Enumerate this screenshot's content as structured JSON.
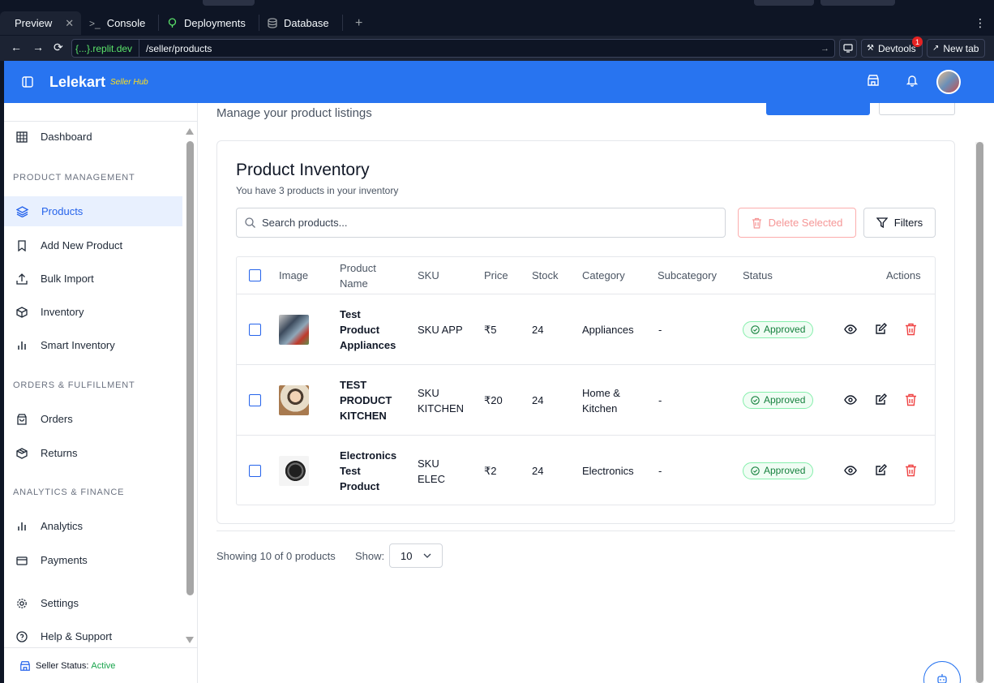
{
  "ide": {
    "tabs": [
      {
        "label": "Preview",
        "icon": "monitor-icon",
        "active": true
      },
      {
        "label": "Console",
        "icon": "terminal-icon"
      },
      {
        "label": "Deployments",
        "icon": "deploy-icon"
      },
      {
        "label": "Database",
        "icon": "database-icon"
      }
    ],
    "url_host": "{...}.replit.dev",
    "url_path": "/seller/products",
    "devtools_label": "Devtools",
    "devtools_badge": "1",
    "newtab_label": "New tab"
  },
  "app": {
    "brand": "Lelekart",
    "brand_sub": "Seller Hub",
    "sidebar": {
      "dashboard": "Dashboard",
      "sections": {
        "product": "PRODUCT MANAGEMENT",
        "orders": "ORDERS & FULFILLMENT",
        "analytics": "ANALYTICS & FINANCE"
      },
      "items": {
        "products": "Products",
        "add_new": "Add New Product",
        "bulk_import": "Bulk Import",
        "inventory": "Inventory",
        "smart_inventory": "Smart Inventory",
        "orders": "Orders",
        "returns": "Returns",
        "analytics": "Analytics",
        "payments": "Payments",
        "settings": "Settings",
        "help": "Help & Support"
      },
      "footer_label": "Seller Status:",
      "footer_value": "Active"
    },
    "page_subtitle": "Manage your product listings",
    "card": {
      "title": "Product Inventory",
      "subtitle": "You have 3 products in your inventory",
      "search_placeholder": "Search products...",
      "delete_label": "Delete Selected",
      "filters_label": "Filters"
    },
    "table": {
      "headers": {
        "image": "Image",
        "name_1": "Product",
        "name_2": "Name",
        "sku": "SKU",
        "price": "Price",
        "stock": "Stock",
        "category": "Category",
        "subcategory": "Subcategory",
        "status": "Status",
        "actions": "Actions"
      },
      "rows": [
        {
          "name_lines": [
            "Test",
            "Product",
            "Appliances"
          ],
          "sku_lines": [
            "SKU APP"
          ],
          "price": "₹5",
          "stock": "24",
          "category_lines": [
            "Appliances"
          ],
          "subcategory": "-",
          "status": "Approved"
        },
        {
          "name_lines": [
            "TEST",
            "PRODUCT",
            "KITCHEN"
          ],
          "sku_lines": [
            "SKU",
            "KITCHEN"
          ],
          "price": "₹20",
          "stock": "24",
          "category_lines": [
            "Home &",
            "Kitchen"
          ],
          "subcategory": "-",
          "status": "Approved"
        },
        {
          "name_lines": [
            "Electronics",
            "Test",
            "Product"
          ],
          "sku_lines": [
            "SKU",
            "ELEC"
          ],
          "price": "₹2",
          "stock": "24",
          "category_lines": [
            "Electronics"
          ],
          "subcategory": "-",
          "status": "Approved"
        }
      ]
    },
    "pager": {
      "showing": "Showing 10 of 0 products",
      "show_label": "Show:",
      "page_size": "10"
    }
  }
}
